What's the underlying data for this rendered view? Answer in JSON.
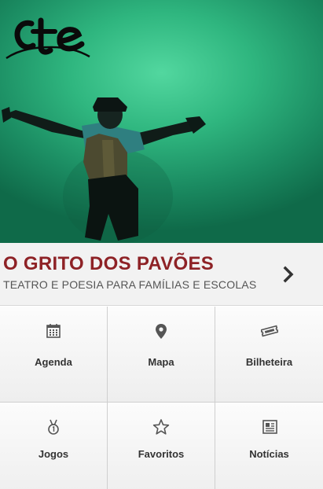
{
  "hero": {
    "logo_text": "cte",
    "image_icon": "performer-photo"
  },
  "event": {
    "title": "O GRITO DOS PAVÕES",
    "subtitle": "TEATRO E POESIA PARA FAMÍLIAS E ESCOLAS",
    "chevron_icon": "chevron-right-icon"
  },
  "menu": {
    "items": [
      {
        "label": "Agenda",
        "icon": "calendar-icon"
      },
      {
        "label": "Mapa",
        "icon": "map-pin-icon"
      },
      {
        "label": "Bilheteira",
        "icon": "ticket-icon"
      },
      {
        "label": "Jogos",
        "icon": "medal-icon"
      },
      {
        "label": "Favoritos",
        "icon": "star-icon"
      },
      {
        "label": "Notícias",
        "icon": "newspaper-icon"
      }
    ]
  },
  "colors": {
    "title": "#8e2226",
    "hero_green": "#2fb67f"
  }
}
